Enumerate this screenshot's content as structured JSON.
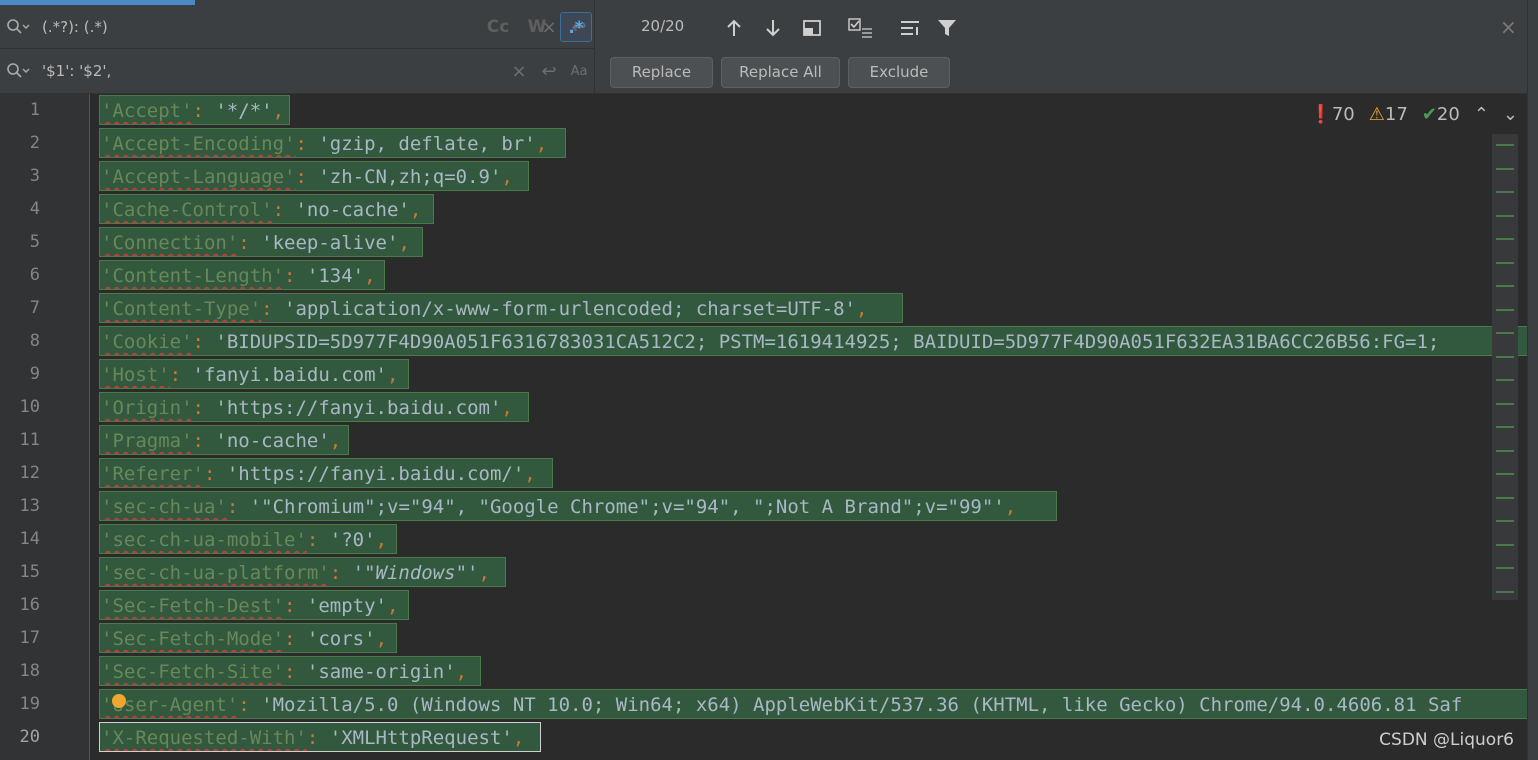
{
  "find": {
    "search_value": "(.*?): (.*)",
    "replace_value": "'$1': '$2',",
    "options": {
      "match_case": "Cc",
      "words": "W",
      "regex": ".*"
    },
    "counter": "20/20",
    "buttons": {
      "replace": "Replace",
      "replace_all": "Replace All",
      "exclude": "Exclude"
    }
  },
  "inspections": {
    "errors": "70",
    "warnings": "17",
    "ok": "20"
  },
  "lines": [
    {
      "n": "1",
      "key": "'Accept'",
      "val": "'*/*'"
    },
    {
      "n": "2",
      "key": "'Accept-Encoding'",
      "val": "'gzip, deflate, br'"
    },
    {
      "n": "3",
      "key": "'Accept-Language'",
      "val": "'zh-CN,zh;q=0.9'"
    },
    {
      "n": "4",
      "key": "'Cache-Control'",
      "val": "'no-cache'"
    },
    {
      "n": "5",
      "key": "'Connection'",
      "val": "'keep-alive'"
    },
    {
      "n": "6",
      "key": "'Content-Length'",
      "val": "'134'"
    },
    {
      "n": "7",
      "key": "'Content-Type'",
      "val": "'application/x-www-form-urlencoded; charset=UTF-8'"
    },
    {
      "n": "8",
      "key": "'Cookie'",
      "val": "'BIDUPSID=5D977F4D90A051F6316783031CA512C2; PSTM=1619414925; BAIDUID=5D977F4D90A051F632EA31BA6CC26B56:FG=1; "
    },
    {
      "n": "9",
      "key": "'Host'",
      "val": "'fanyi.baidu.com'"
    },
    {
      "n": "10",
      "key": "'Origin'",
      "val": "'https://fanyi.baidu.com'"
    },
    {
      "n": "11",
      "key": "'Pragma'",
      "val": "'no-cache'"
    },
    {
      "n": "12",
      "key": "'Referer'",
      "val": "'https://fanyi.baidu.com/'"
    },
    {
      "n": "13",
      "key": "'sec-ch-ua'",
      "val": "'\"Chromium\";v=\"94\", \"Google Chrome\";v=\"94\", \";Not A Brand\";v=\"99\"'"
    },
    {
      "n": "14",
      "key": "'sec-ch-ua-mobile'",
      "val": "'?0'"
    },
    {
      "n": "15",
      "key": "'sec-ch-ua-platform'",
      "val": "'\"Windows\"'"
    },
    {
      "n": "16",
      "key": "'Sec-Fetch-Dest'",
      "val": "'empty'"
    },
    {
      "n": "17",
      "key": "'Sec-Fetch-Mode'",
      "val": "'cors'"
    },
    {
      "n": "18",
      "key": "'Sec-Fetch-Site'",
      "val": "'same-origin'"
    },
    {
      "n": "19",
      "key": "'User-Agent'",
      "val": "'Mozilla/5.0 (Windows NT 10.0; Win64; x64) AppleWebKit/537.36 (KHTML, like Gecko) Chrome/94.0.4606.81 Saf"
    },
    {
      "n": "20",
      "key": "'X-Requested-With'",
      "val": "'XMLHttpRequest'"
    }
  ],
  "watermark": "CSDN @Liquor6",
  "colors": {
    "match_bg": "#32593d",
    "string": "#6a8759",
    "accent": "#4a88c7"
  }
}
